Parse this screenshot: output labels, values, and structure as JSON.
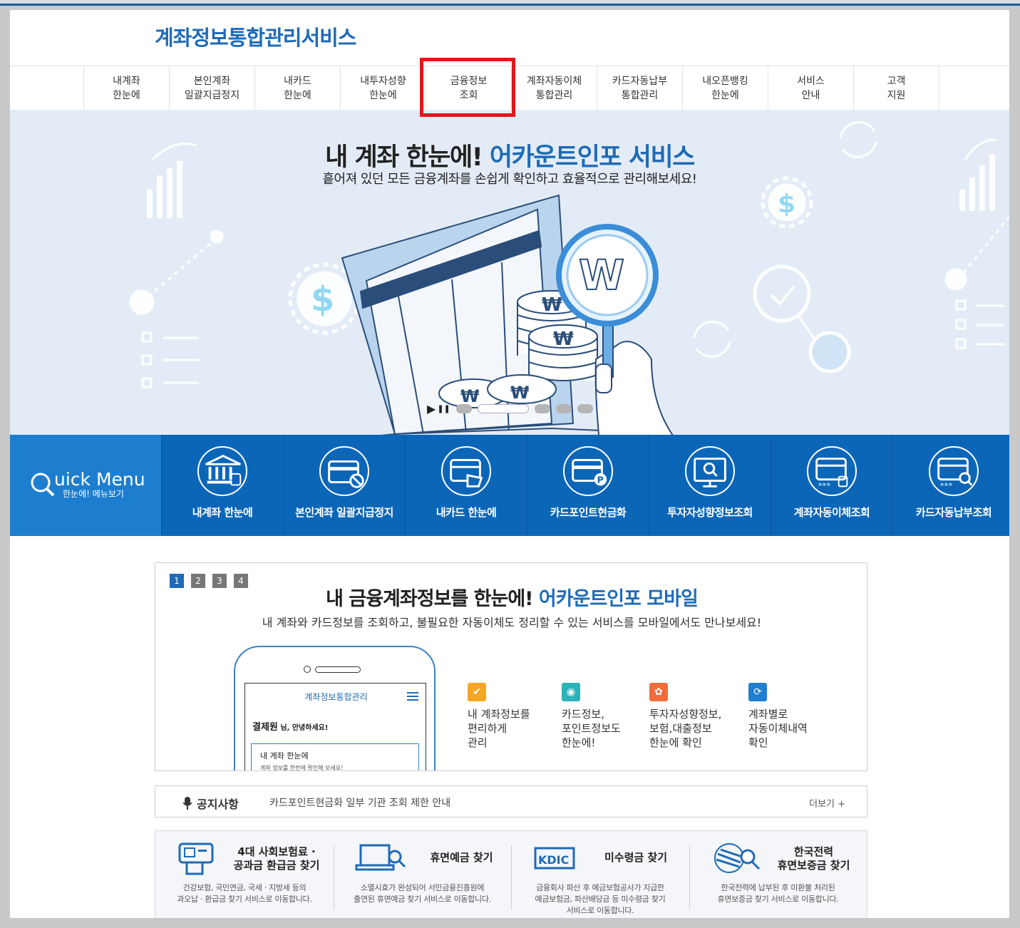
{
  "site": {
    "title": "계좌정보통합관리서비스"
  },
  "gnb": [
    {
      "label": "내계좌\n한눈에"
    },
    {
      "label": "본인계좌\n일괄지급정지"
    },
    {
      "label": "내카드\n한눈에"
    },
    {
      "label": "내투자성향\n한눈에"
    },
    {
      "label": "금융정보\n조회"
    },
    {
      "label": "계좌자동이체\n통합관리"
    },
    {
      "label": "카드자동납부\n통합관리"
    },
    {
      "label": "내오픈뱅킹\n한눈에"
    },
    {
      "label": "서비스\n안내"
    },
    {
      "label": "고객\n지원"
    }
  ],
  "hero": {
    "title_dark": "내 계좌 한눈에! ",
    "title_blue": "어카운트인포 서비스",
    "subtitle": "흩어져 있던 모든 금융계좌를 손쉽게 확인하고 효율적으로 관리해보세요!",
    "play_icon": "▶",
    "pause_icon": "❚❚"
  },
  "quick_menu": {
    "title_letter_icon": "search-icon",
    "title": "uick Menu",
    "subtitle": "한눈에! 메뉴보기",
    "items": [
      {
        "label": "내계좌 한눈에",
        "icon": "bank-icon"
      },
      {
        "label": "본인계좌 일괄지급정지",
        "icon": "card-stop-icon"
      },
      {
        "label": "내카드 한눈에",
        "icon": "card-hand-icon"
      },
      {
        "label": "카드포인트현금화",
        "icon": "card-point-icon"
      },
      {
        "label": "투자자성향정보조회",
        "icon": "monitor-search-icon"
      },
      {
        "label": "계좌자동이체조회",
        "icon": "card-transfer-icon"
      },
      {
        "label": "카드자동납부조회",
        "icon": "card-search-icon"
      }
    ]
  },
  "mobile": {
    "pages": [
      "1",
      "2",
      "3",
      "4"
    ],
    "title_dark": "내 금융계좌정보를 한눈에! ",
    "title_blue": "어카운트인포 모바일",
    "subtitle": "내 계좌와 카드정보를 조회하고, 불필요한 자동이체도 정리할 수 있는 서비스를 모바일에서도 만나보세요!",
    "phone": {
      "header": "계좌정보통합관리",
      "greet_name": "결제원",
      "greet_suffix": " 님, 안녕하세요!",
      "card_title": "내 계좌 한눈에",
      "card_desc": "계좌 정보를 한번에 확인해 보세요!"
    },
    "features": [
      {
        "text": "내 계좌정보를\n편리하게\n관리",
        "icon": "check-icon",
        "color": "#f5a623"
      },
      {
        "text": "카드정보,\n포인트정보도\n한눈에!",
        "icon": "eye-icon",
        "color": "#2bb3b8"
      },
      {
        "text": "투자자성향정보,\n보험,대출정보\n한눈에 확인",
        "icon": "gear-icon",
        "color": "#f26b3a"
      },
      {
        "text": "계좌별로\n자동이체내역\n확인",
        "icon": "refresh-icon",
        "color": "#1f7fd1"
      }
    ]
  },
  "notice": {
    "label": "공지사항",
    "text": "카드포인트현금화 일부 기관 조회 제한 안내",
    "more": "더보기 +"
  },
  "services": [
    {
      "title": "4대 사회보험료 ·\n공과금 환급금 찾기",
      "desc": "건강보험, 국민연금, 국세 · 지방세 등의\n과오납 · 환급금 찾기 서비스로 이동합니다.",
      "icon": "atm-icon"
    },
    {
      "title": "휴면예금 찾기",
      "desc": "소멸시효가 완성되어 서민금융진흥원에\n출연된 휴면예금 찾기 서비스로 이동합니다.",
      "icon": "laptop-search-icon"
    },
    {
      "title": "미수령금 찾기",
      "desc": "금융회사 파산 후 예금보험공사가 지급한\n예금보험금, 파산배당금 등 미수령금 찾기\n서비스로 이동합니다.",
      "icon": "kdic-logo",
      "logo_text": "KDIC"
    },
    {
      "title": "한국전력\n휴면보증금 찾기",
      "desc": "한국전력에 납부된 후 미환불 처리된\n휴면보증금 찾기 서비스로 이동합니다.",
      "icon": "kepco-search-icon"
    }
  ]
}
